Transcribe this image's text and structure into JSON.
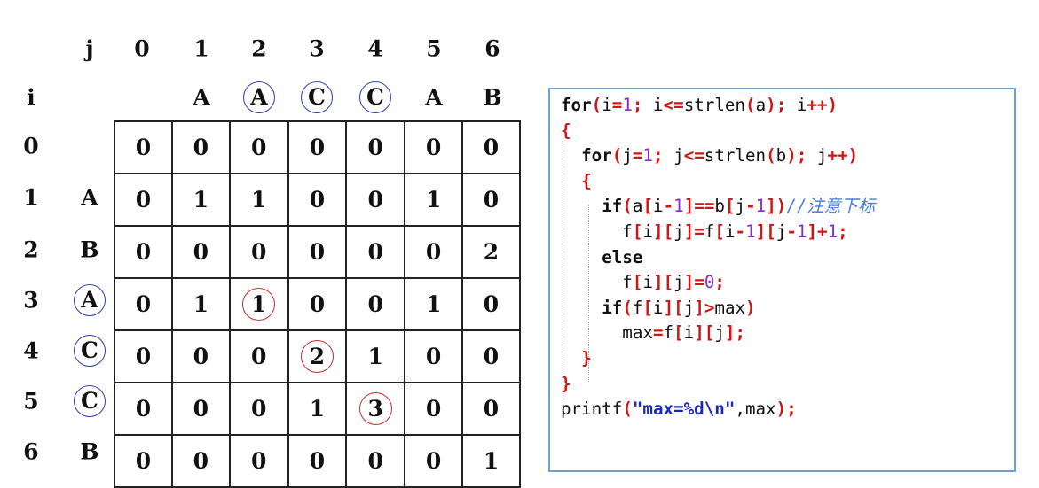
{
  "matrix": {
    "corner_labels": {
      "j": "j",
      "i": "i"
    },
    "j_indices": [
      "0",
      "1",
      "2",
      "3",
      "4",
      "5",
      "6"
    ],
    "string_b": [
      "",
      "A",
      "A",
      "C",
      "C",
      "A",
      "B"
    ],
    "i_indices": [
      "0",
      "1",
      "2",
      "3",
      "4",
      "5",
      "6"
    ],
    "string_a": [
      "",
      "A",
      "B",
      "A",
      "C",
      "C",
      "B"
    ],
    "cells": [
      [
        "0",
        "0",
        "0",
        "0",
        "0",
        "0",
        "0"
      ],
      [
        "0",
        "1",
        "1",
        "0",
        "0",
        "1",
        "0"
      ],
      [
        "0",
        "0",
        "0",
        "0",
        "0",
        "0",
        "2"
      ],
      [
        "0",
        "1",
        "1",
        "0",
        "0",
        "1",
        "0"
      ],
      [
        "0",
        "0",
        "0",
        "2",
        "1",
        "0",
        "0"
      ],
      [
        "0",
        "0",
        "0",
        "1",
        "3",
        "0",
        "0"
      ],
      [
        "0",
        "0",
        "0",
        "0",
        "0",
        "0",
        "1"
      ]
    ],
    "circled_b_columns": [
      2,
      3,
      4
    ],
    "circled_a_rows": [
      3,
      4,
      5
    ],
    "circled_cells": [
      [
        3,
        2
      ],
      [
        4,
        3
      ],
      [
        5,
        4
      ]
    ],
    "colors": {
      "blue_circle": "#2d3fb5",
      "red_circle": "#c43030",
      "grid": "#222222"
    }
  },
  "code": {
    "lines": [
      "for(i=1; i<=strlen(a); i++)",
      "{",
      "  for(j=1; j<=strlen(b); j++)",
      "  {",
      "    if(a[i-1]==b[j-1])//注意下标",
      "      f[i][j]=f[i-1][j-1]+1;",
      "    else",
      "      f[i][j]=0;",
      "    if(f[i][j]>max)",
      "      max=f[i][j];",
      "  }",
      "}",
      "printf(\"max=%d\\n\",max);"
    ],
    "border_color": "#6f9fd6"
  }
}
